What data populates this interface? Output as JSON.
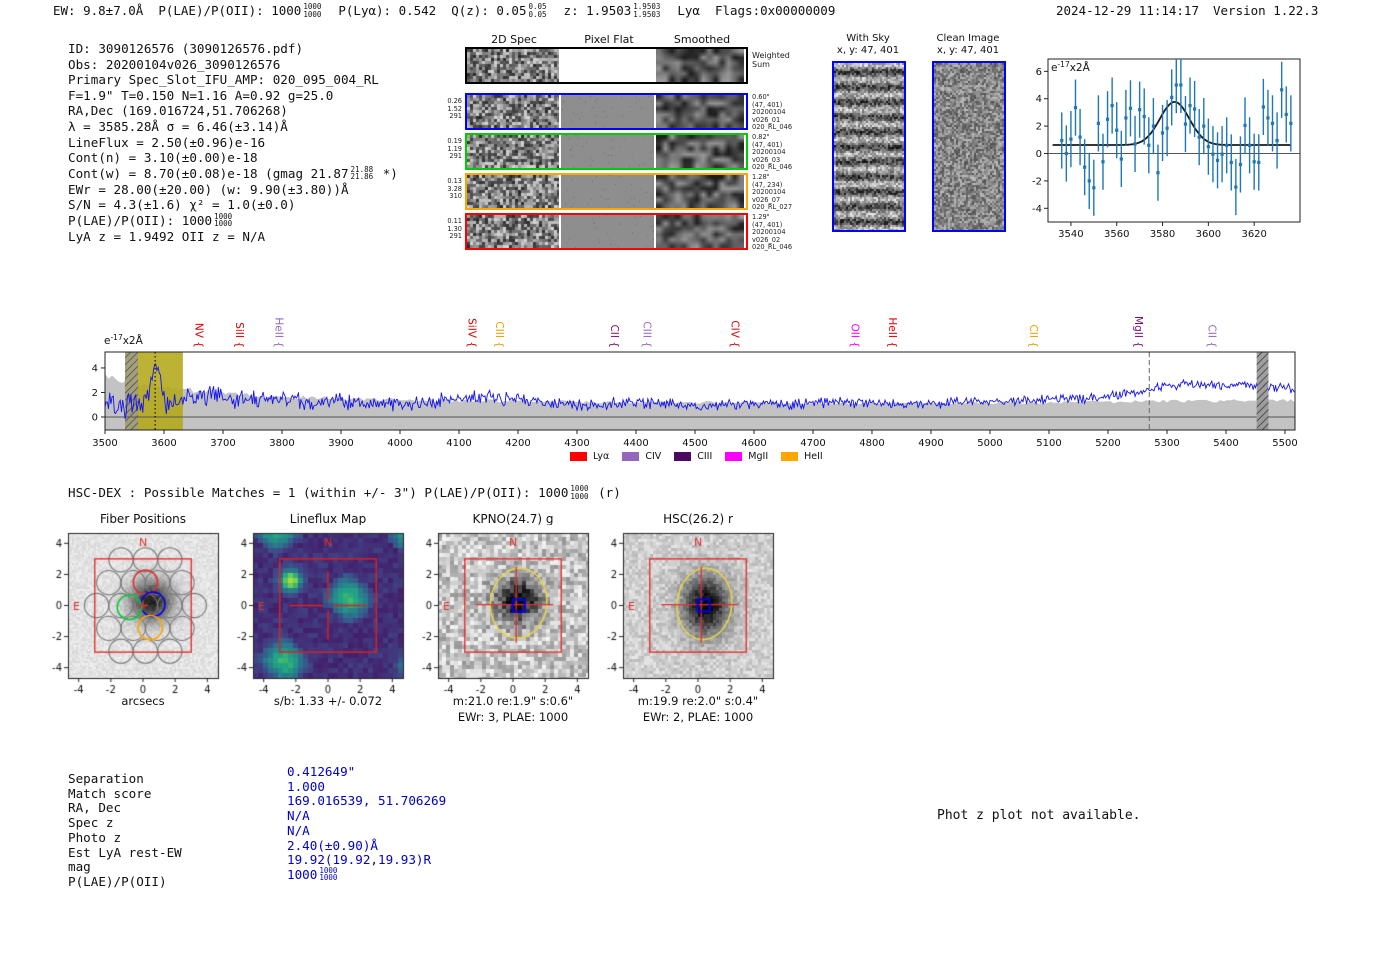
{
  "colors": {
    "value_blue": "#0000cc",
    "spectrum_line": "#1414f0",
    "error_band": "#c3c3c3",
    "highlight_olive": "#b3a818",
    "marker_point": "#1f77b4",
    "fit_line": "#1a1a1a",
    "compass_red": "#e03030",
    "aperture_yellow": "#e8d44d",
    "box_blue": "#0000ff"
  },
  "header": {
    "segments": [
      {
        "t": "EW: 9.8±7.0Å"
      },
      {
        "t": "P(LAE)/P(OII): 1000",
        "frac": [
          "1000",
          "1000"
        ]
      },
      {
        "t": "P(Lyα): 0.542"
      },
      {
        "t": "Q(z): 0.05",
        "frac": [
          "0.05",
          "0.05"
        ]
      },
      {
        "t": "z: 1.9503",
        "frac": [
          "1.9503",
          "1.9503"
        ]
      },
      {
        "t": "Lyα"
      },
      {
        "t": "Flags:0x00000009"
      }
    ],
    "datetime": "2024-12-29 11:14:17",
    "version": "Version 1.22.3"
  },
  "info_lines": [
    {
      "t": "ID: 3090126576 (3090126576.pdf)"
    },
    {
      "t": "Obs: 20200104v026_3090126576"
    },
    {
      "t": "Primary Spec_Slot_IFU_AMP: 020_095_004_RL"
    },
    {
      "t": "F=1.9\"  T=0.150  N=1.16  A=0.92  g=25.0"
    },
    {
      "t": "RA,Dec (169.016724,51.706268)"
    },
    {
      "t": "λ = 3585.28Å  σ = 6.46(±3.14)Å"
    },
    {
      "t": "LineFlux = 2.50(±0.96)e-16"
    },
    {
      "t": "Cont(n) = 3.10(±0.00)e-18"
    },
    {
      "t": "Cont(w) = 8.70(±0.08)e-18 (gmag 21.87",
      "frac": [
        "21.88",
        "21.86"
      ],
      "post": " *)"
    },
    {
      "t": "EWr = 28.00(±20.00) (w: 9.90(±3.80))Å"
    },
    {
      "t": "S/N = 4.3(±1.6)  χ² = 1.0(±0.0)"
    },
    {
      "t": "P(LAE)/P(OII): 1000",
      "frac": [
        "1000",
        "1000"
      ]
    },
    {
      "t": "LyA z = 1.9492  OII z = N/A"
    }
  ],
  "spec2d": {
    "column_titles": [
      "2D Spec",
      "Pixel Flat",
      "Smoothed"
    ],
    "rows": [
      {
        "border": "#000000",
        "left_labels": [],
        "right_labels": [
          "Weighted",
          "Sum"
        ],
        "flat": "white"
      },
      {
        "border": "#0000ff",
        "left_labels": [
          "0.26",
          "1.52",
          "291"
        ],
        "right_labels": [
          "0.60\"",
          "(47, 401)",
          "20200104",
          "v026_01",
          "020_RL_046"
        ],
        "flat": "gray"
      },
      {
        "border": "#00cc00",
        "left_labels": [
          "0.19",
          "1.19",
          "291"
        ],
        "right_labels": [
          "0.82\"",
          "(47, 401)",
          "20200104",
          "v026_03",
          "020_RL_046"
        ],
        "flat": "gray"
      },
      {
        "border": "#ffa500",
        "left_labels": [
          "0.13",
          "3.28",
          "310"
        ],
        "right_labels": [
          "1.28\"",
          "(47, 234)",
          "20200104",
          "v026_07",
          "020_RL_027"
        ],
        "flat": "gray"
      },
      {
        "border": "#ff0000",
        "left_labels": [
          "0.11",
          "1.30",
          "291"
        ],
        "right_labels": [
          "1.29\"",
          "(47, 401)",
          "20200104",
          "v026_02",
          "020_RL_046"
        ],
        "flat": "gray"
      }
    ]
  },
  "sky_panels": {
    "with_sky_title": "With Sky",
    "with_sky_sub": "x, y: 47, 401",
    "clean_title": "Clean Image",
    "clean_sub": "x, y: 47, 401"
  },
  "hscdex_line": {
    "pre": "HSC-DEX : Possible Matches = 1 (within +/- 3\")  P(LAE)/P(OII): 1000",
    "frac": [
      "1000",
      "1000"
    ],
    "post": " (r)"
  },
  "cutouts": {
    "ticks": [
      -4,
      -2,
      0,
      2,
      4
    ],
    "compass_n": "N",
    "compass_e": "E",
    "fiber": {
      "title": "Fiber Positions",
      "xlabel": "arcsecs"
    },
    "lineflux": {
      "title": "Lineflux Map",
      "xlabel": "s/b: 1.33 +/- 0.072"
    },
    "kpno": {
      "title": "KPNO(24.7) g",
      "xlabel1": "m:21.0 re:1.9\" s:0.6\"",
      "xlabel2": "EWr: 3, PLAE: 1000"
    },
    "hsc": {
      "title": "HSC(26.2) r",
      "xlabel1": "m:19.9 re:2.0\" s:0.4\"",
      "xlabel2": "EWr: 2, PLAE: 1000"
    }
  },
  "match_table": {
    "rows": [
      {
        "label": "Separation",
        "value": "0.412649\""
      },
      {
        "label": "Match score",
        "value": "1.000"
      },
      {
        "label": "RA, Dec",
        "value": "169.016539, 51.706269"
      },
      {
        "label": "Spec z",
        "value": "N/A"
      },
      {
        "label": "Photo z",
        "value": "N/A"
      },
      {
        "label": "Est LyA rest-EW",
        "value": "2.40(±0.90)Å"
      },
      {
        "label": "mag",
        "value": "19.92(19.92,19.93)R"
      },
      {
        "label": "P(LAE)/P(OII)",
        "value": "1000",
        "frac": [
          "1000",
          "1000"
        ]
      }
    ]
  },
  "photz_notice": "Phot z plot not available.",
  "chart_data": [
    {
      "id": "line_fit_inset",
      "type": "scatter",
      "title": "",
      "ylabel_base": "e",
      "ylabel_sup": "-17",
      "ylabel_rest": "x2Å",
      "xlim": [
        3530,
        3640
      ],
      "ylim": [
        -5.0,
        6.9
      ],
      "xticks": [
        3540,
        3560,
        3580,
        3600,
        3620
      ],
      "yticks": [
        -4,
        -2,
        0,
        2,
        4,
        6
      ],
      "x_start": 3536,
      "x_step": 2,
      "y": [
        0.95,
        0.0,
        1.05,
        3.35,
        1.2,
        -1.0,
        -2.0,
        -2.5,
        2.2,
        -0.6,
        2.5,
        3.5,
        1.7,
        -0.4,
        2.6,
        3.3,
        0.7,
        3.2,
        2.7,
        0.6,
        2.0,
        -1.4,
        1.5,
        1.85,
        4.1,
        5.0,
        5.0,
        2.15,
        3.5,
        3.25,
        1.2,
        2.0,
        0.5,
        -0.05,
        -0.5,
        -0.05,
        0.6,
        -0.65,
        -2.45,
        -0.8,
        2.05,
        0.6,
        -0.6,
        -0.65,
        3.4,
        2.6,
        2.2,
        0.95,
        4.65,
        2.85,
        2.2
      ],
      "yerr": 2.05,
      "fit": {
        "type": "gaussian",
        "center": 3585.28,
        "sigma": 6.46,
        "amplitude": 3.15,
        "baseline": 0.62
      }
    },
    {
      "id": "full_spectrum",
      "type": "line",
      "ylabel_base": "e",
      "ylabel_sup": "-17",
      "ylabel_rest": "x2Å",
      "xlim": [
        3500,
        5517
      ],
      "ylim": [
        -1.06,
        5.3
      ],
      "xticks": [
        3500,
        3600,
        3700,
        3800,
        3900,
        4000,
        4100,
        4200,
        4300,
        4400,
        4500,
        4600,
        4700,
        4800,
        4900,
        5000,
        5100,
        5200,
        5300,
        5400,
        5500
      ],
      "yticks": [
        0,
        2,
        4
      ],
      "envelope": [
        [
          3500,
          1.8
        ],
        [
          3520,
          1.2
        ],
        [
          3545,
          1.0
        ],
        [
          3570,
          1.2
        ],
        [
          3585,
          4.8
        ],
        [
          3600,
          1.2
        ],
        [
          3640,
          1.6
        ],
        [
          3680,
          1.8
        ],
        [
          3720,
          1.4
        ],
        [
          3760,
          1.3
        ],
        [
          3800,
          1.5
        ],
        [
          3850,
          1.2
        ],
        [
          3900,
          1.3
        ],
        [
          3950,
          1.0
        ],
        [
          4000,
          1.1
        ],
        [
          4050,
          1.2
        ],
        [
          4100,
          1.5
        ],
        [
          4150,
          1.6
        ],
        [
          4200,
          1.4
        ],
        [
          4250,
          1.1
        ],
        [
          4300,
          1.0
        ],
        [
          4350,
          1.1
        ],
        [
          4400,
          1.2
        ],
        [
          4450,
          1.1
        ],
        [
          4500,
          0.9
        ],
        [
          4550,
          1.0
        ],
        [
          4600,
          1.1
        ],
        [
          4650,
          1.0
        ],
        [
          4700,
          1.1
        ],
        [
          4750,
          1.2
        ],
        [
          4800,
          1.1
        ],
        [
          4850,
          1.0
        ],
        [
          4900,
          1.1
        ],
        [
          4950,
          1.2
        ],
        [
          5000,
          1.3
        ],
        [
          5050,
          1.3
        ],
        [
          5100,
          1.5
        ],
        [
          5150,
          1.5
        ],
        [
          5200,
          1.7
        ],
        [
          5250,
          2.0
        ],
        [
          5300,
          2.6
        ],
        [
          5350,
          2.6
        ],
        [
          5400,
          2.5
        ],
        [
          5450,
          2.6
        ],
        [
          5500,
          2.4
        ],
        [
          5520,
          2.2
        ]
      ],
      "noise_amp": [
        [
          3500,
          1.7
        ],
        [
          3560,
          1.5
        ],
        [
          3600,
          1.3
        ],
        [
          3650,
          1.2
        ],
        [
          3700,
          1.0
        ],
        [
          3800,
          0.85
        ],
        [
          3900,
          0.75
        ],
        [
          4100,
          0.7
        ],
        [
          4300,
          0.6
        ],
        [
          4600,
          0.5
        ],
        [
          5000,
          0.5
        ],
        [
          5200,
          0.45
        ],
        [
          5520,
          0.5
        ]
      ],
      "band_halfwidth": [
        [
          3500,
          3.2
        ],
        [
          3550,
          2.8
        ],
        [
          3600,
          2.4
        ],
        [
          3650,
          2.1
        ],
        [
          3700,
          1.9
        ],
        [
          3750,
          1.7
        ],
        [
          3800,
          1.6
        ],
        [
          3900,
          1.45
        ],
        [
          4000,
          1.35
        ],
        [
          4100,
          1.3
        ],
        [
          4200,
          1.25
        ],
        [
          4300,
          1.2
        ],
        [
          4500,
          1.15
        ],
        [
          4700,
          1.1
        ],
        [
          4900,
          1.1
        ],
        [
          5100,
          1.15
        ],
        [
          5300,
          1.25
        ],
        [
          5520,
          1.3
        ]
      ],
      "regions": {
        "olive": [
          3534,
          3632
        ],
        "hatch_left": [
          3534,
          3556
        ],
        "dotted_vline": 3585,
        "dashed_vline": 5270,
        "hatch_bar": [
          5452,
          5472
        ]
      },
      "line_markers": [
        {
          "wave": 3659,
          "label": "NV",
          "color": "#dd0000"
        },
        {
          "wave": 3728,
          "label": "SiII",
          "color": "#dd0000"
        },
        {
          "wave": 3795,
          "label": "HeII",
          "color": "#9467bd"
        },
        {
          "wave": 4122,
          "label": "SiIV",
          "color": "#dd0000"
        },
        {
          "wave": 4169,
          "label": "CIII",
          "color": "#e8a000"
        },
        {
          "wave": 4364,
          "label": "CII",
          "color": "#8b0f62"
        },
        {
          "wave": 4419,
          "label": "CIII",
          "color": "#9467bd"
        },
        {
          "wave": 4568,
          "label": "CIV",
          "color": "#dd0000"
        },
        {
          "wave": 4771,
          "label": "OII",
          "color": "#ff00ff"
        },
        {
          "wave": 4835,
          "label": "HeII",
          "color": "#dd0000"
        },
        {
          "wave": 5074,
          "label": "CII",
          "color": "#e8a000"
        },
        {
          "wave": 5252,
          "label": "MgII",
          "color": "#7d0f7d"
        },
        {
          "wave": 5376,
          "label": "CII",
          "color": "#9467bd"
        }
      ],
      "legend": [
        {
          "label": "Lyα",
          "color": "#ff0000"
        },
        {
          "label": "CIV",
          "color": "#9467bd"
        },
        {
          "label": "CIII",
          "color": "#4b0a5f"
        },
        {
          "label": "MgII",
          "color": "#ff00ff"
        },
        {
          "label": "HeII",
          "color": "#ffa500"
        }
      ]
    }
  ]
}
